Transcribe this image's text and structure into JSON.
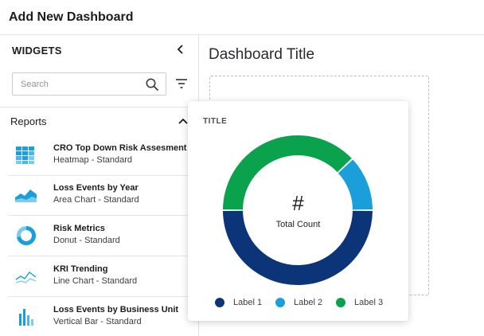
{
  "header": {
    "title": "Add New Dashboard"
  },
  "sidebar": {
    "heading": "WIDGETS",
    "search": {
      "placeholder": "Search",
      "value": ""
    },
    "section": "Reports",
    "reports": [
      {
        "name": "CRO Top Down Risk Assesment",
        "subtitle": "Heatmap - Standard",
        "icon": "heatmap-icon"
      },
      {
        "name": "Loss Events by Year",
        "subtitle": "Area Chart - Standard",
        "icon": "area-chart-icon"
      },
      {
        "name": "Risk Metrics",
        "subtitle": "Donut - Standard",
        "icon": "donut-chart-icon"
      },
      {
        "name": "KRI Trending",
        "subtitle": "Line Chart - Standard",
        "icon": "line-chart-icon"
      },
      {
        "name": "Loss Events by Business Unit",
        "subtitle": "Vertical Bar - Standard",
        "icon": "vertical-bar-icon"
      }
    ]
  },
  "main": {
    "dashboard_title": "Dashboard Title"
  },
  "widget": {
    "title": "TITLE",
    "center_value": "#",
    "center_label": "Total Count"
  },
  "colors": {
    "accent": "#1a9fdb",
    "label1": "#0b3578",
    "label2": "#1a9fdb",
    "label3": "#0aa24c"
  },
  "chart_data": {
    "type": "pie",
    "subtype": "donut",
    "title": "TITLE",
    "categories": [
      "Label 1",
      "Label 2",
      "Label 3"
    ],
    "values": [
      50,
      12,
      38
    ],
    "colors": [
      "#0b3578",
      "#1a9fdb",
      "#0aa24c"
    ],
    "legend": "bottom"
  }
}
